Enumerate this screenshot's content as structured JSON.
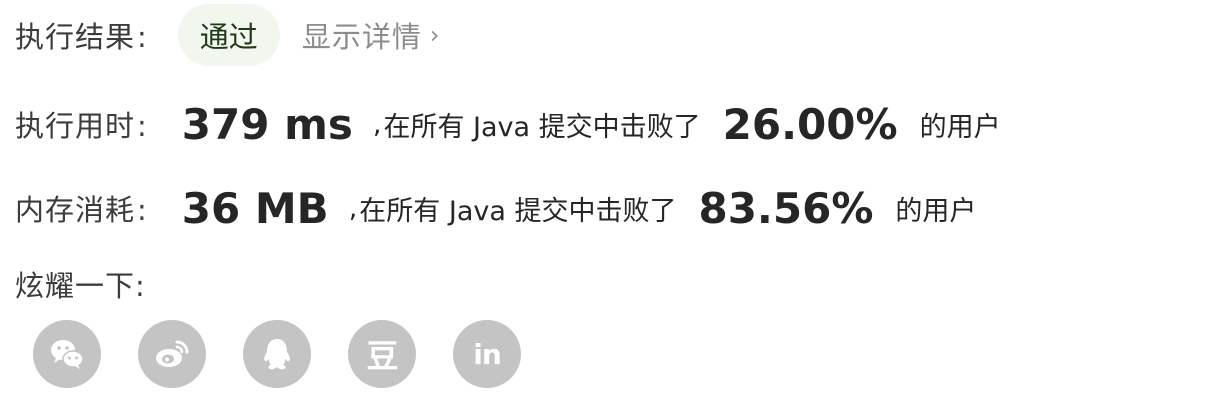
{
  "result": {
    "label": "执行结果",
    "colon": ":",
    "status": "通过",
    "detail_link": "显示详情",
    "detail_chevron": "›"
  },
  "time": {
    "label": "执行用时",
    "colon": ":",
    "value": "379 ms",
    "separator": ",",
    "desc": "在所有 Java 提交中击败了",
    "percent": "26.00%",
    "tail": "的用户"
  },
  "memory": {
    "label": "内存消耗",
    "colon": ":",
    "value": "36 MB",
    "separator": ",",
    "desc": "在所有 Java 提交中击败了",
    "percent": "83.56%",
    "tail": "的用户"
  },
  "share": {
    "label": "炫耀一下:",
    "icons": [
      "wechat-icon",
      "weibo-icon",
      "qq-icon",
      "douban-icon",
      "linkedin-icon"
    ],
    "douban_glyph": "豆",
    "linkedin_glyph": "in"
  },
  "colors": {
    "pass_badge_bg": "#f1f6ee",
    "pass_text": "#1f3a17",
    "muted": "#8c8c8c",
    "icon_bg": "#c4c4c4"
  }
}
